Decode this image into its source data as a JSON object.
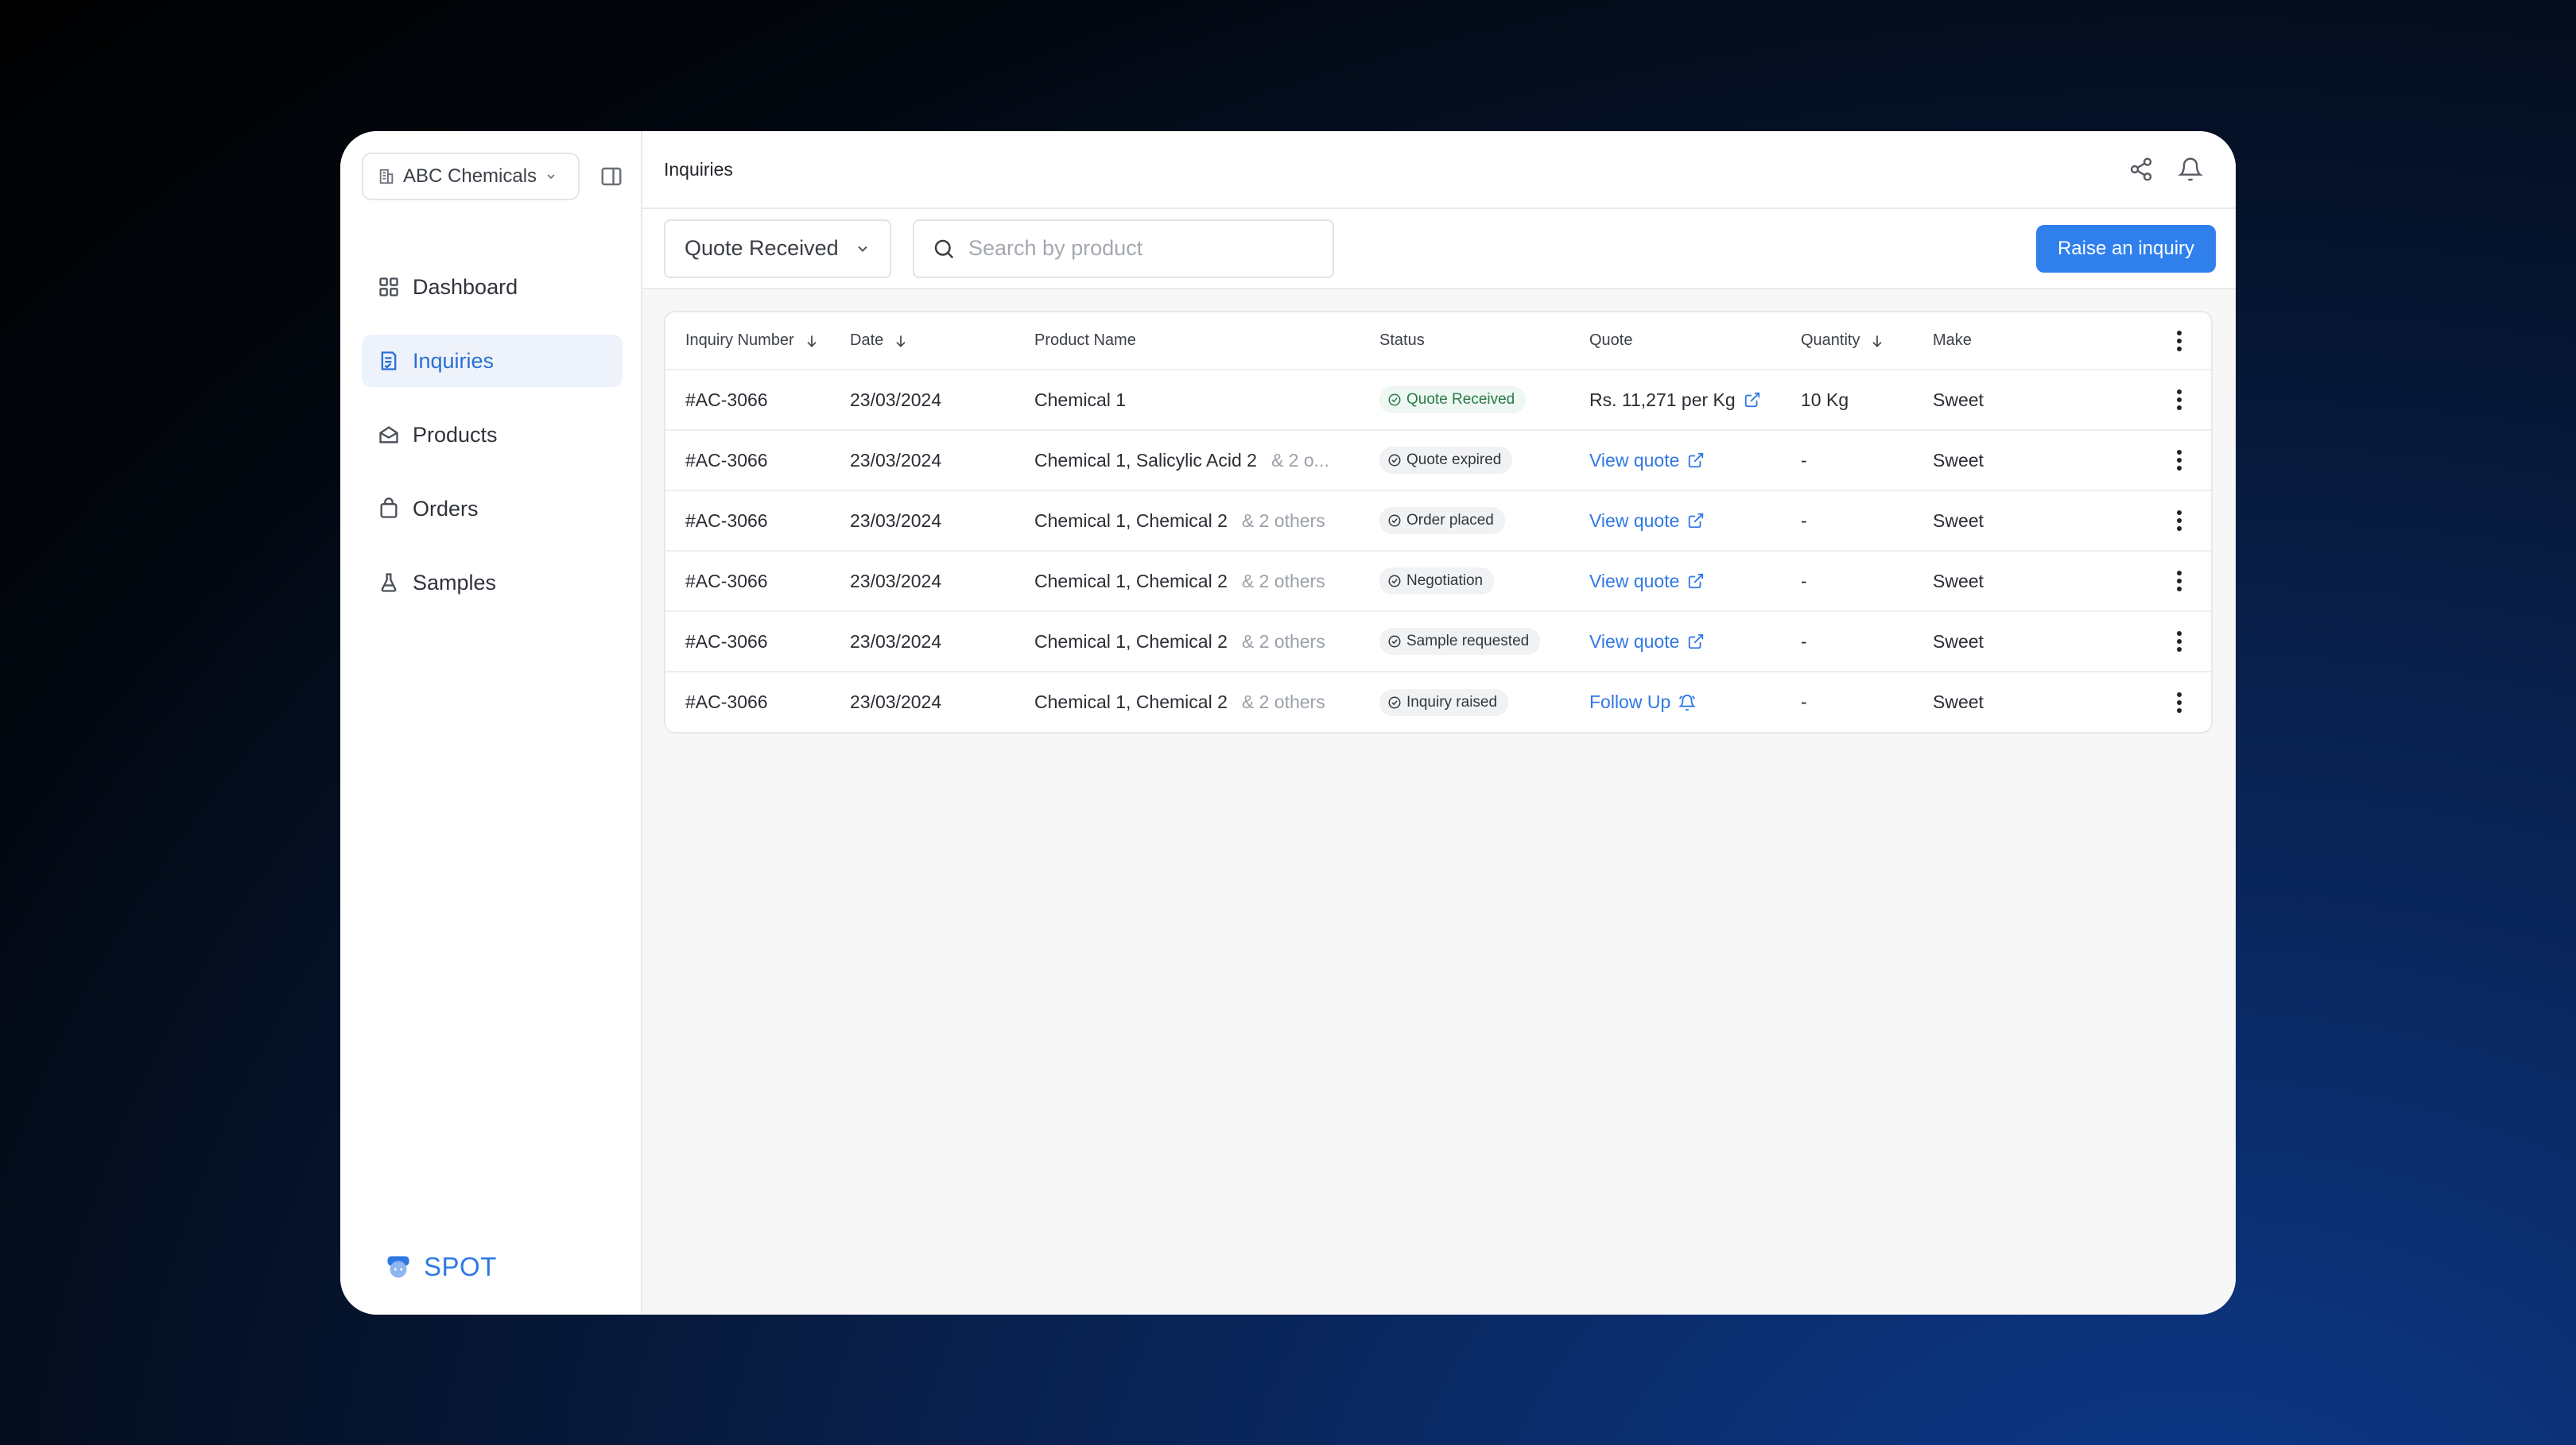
{
  "sidebar": {
    "org_name": "ABC Chemicals",
    "items": [
      {
        "label": "Dashboard",
        "icon": "grid-icon"
      },
      {
        "label": "Inquiries",
        "icon": "document-icon",
        "active": true
      },
      {
        "label": "Products",
        "icon": "box-icon"
      },
      {
        "label": "Orders",
        "icon": "bag-icon"
      },
      {
        "label": "Samples",
        "icon": "flask-icon"
      }
    ],
    "brand": "SPOT"
  },
  "header": {
    "title": "Inquiries"
  },
  "toolbar": {
    "status_filter": "Quote Received",
    "search_placeholder": "Search by product",
    "raise_button": "Raise an inquiry"
  },
  "table": {
    "columns": [
      "Inquiry Number",
      "Date",
      "Product Name",
      "Status",
      "Quote",
      "Quantity",
      "Make"
    ],
    "rows": [
      {
        "inquiry": "#AC-3066",
        "date": "23/03/2024",
        "product": "Chemical 1",
        "others": "",
        "status": "Quote Received",
        "quote": "Rs. 11,271 per Kg",
        "quantity": "10 Kg",
        "make": "Sweet"
      },
      {
        "inquiry": "#AC-3066",
        "date": "23/03/2024",
        "product": "Chemical 1, Salicylic Acid 2",
        "others": "& 2 o...",
        "status": "Quote expired",
        "quote": "View quote",
        "quantity": "-",
        "make": "Sweet"
      },
      {
        "inquiry": "#AC-3066",
        "date": "23/03/2024",
        "product": "Chemical 1, Chemical 2",
        "others": "& 2 others",
        "status": "Order placed",
        "quote": "View quote",
        "quantity": "-",
        "make": "Sweet"
      },
      {
        "inquiry": "#AC-3066",
        "date": "23/03/2024",
        "product": "Chemical 1, Chemical 2",
        "others": "& 2 others",
        "status": "Negotiation",
        "quote": "View quote",
        "quantity": "-",
        "make": "Sweet"
      },
      {
        "inquiry": "#AC-3066",
        "date": "23/03/2024",
        "product": "Chemical 1, Chemical 2",
        "others": "& 2 others",
        "status": "Sample requested",
        "quote": "View quote",
        "quantity": "-",
        "make": "Sweet"
      },
      {
        "inquiry": "#AC-3066",
        "date": "23/03/2024",
        "product": "Chemical 1, Chemical 2",
        "others": "& 2 others",
        "status": "Inquiry raised",
        "quote": "Follow Up",
        "quantity": "-",
        "make": "Sweet"
      }
    ]
  },
  "colors": {
    "accent": "#2f80ed",
    "active_bg": "#eef2fb"
  }
}
